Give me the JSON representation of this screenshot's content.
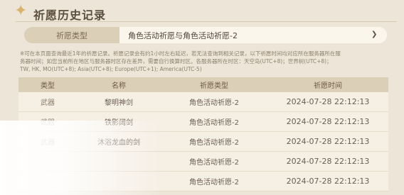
{
  "header": {
    "title": "祈愿历史记录",
    "icon": "sparkle-star-icon"
  },
  "filter": {
    "label": "祈愿类型",
    "selected": "角色活动祈愿与角色活动祈愿-2",
    "icon": "chevron-down-icon"
  },
  "note": {
    "line1": "※可在本页面查询最近1年的祈愿记录。祈愿记录会有约1小时左右延迟，若无法查询到相关记录，以下祈愿时间均对应所在服务器所在服",
    "line2": "务器时间；如您当前所在地区与服务器时区存在差异，需要自行换算时区。各服务器所在时区：天空岛(UTC+8)；世界树(UTC+8)；",
    "line3": "TW, HK, MO(UTC+8); Asia(UTC+8); Europe(UTC+1); America(UTC-5)"
  },
  "table": {
    "headers": [
      "类型",
      "名称",
      "祈愿类型",
      "祈愿时间"
    ],
    "rows": [
      {
        "type": "武器",
        "name": "黎明神剑",
        "wish_type": "角色活动祈愿-2",
        "time": "2024-07-28 22:12:13"
      },
      {
        "type": "武器",
        "name": "铁影阔剑",
        "wish_type": "角色活动祈愿-2",
        "time": "2024-07-28 22:12:13"
      },
      {
        "type": "武器",
        "name": "沐浴龙血的剑",
        "wish_type": "角色活动祈愿-2",
        "time": "2024-07-28 22:12:13"
      },
      {
        "type": "",
        "name": "",
        "wish_type": "角色活动祈愿-2",
        "time": "2024-07-28 22:12:13"
      },
      {
        "type": "",
        "name": "",
        "wish_type": "角色活动祈愿-2",
        "time": "2024-07-28 22:12:13"
      }
    ]
  }
}
